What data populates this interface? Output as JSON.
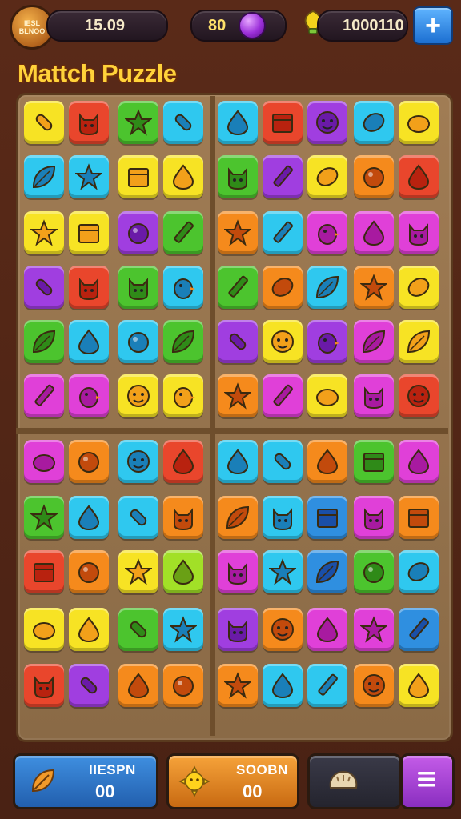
{
  "top_bar": {
    "badge_text": "IESL BLNOO",
    "timer_value": "15.09",
    "gems_value": "80",
    "coins_value": "1000110",
    "add_label": "+"
  },
  "title": "Mattch Puzzle",
  "colors": {
    "yellow": "#f7e324",
    "red": "#e9462c",
    "green": "#4cc42e",
    "cyan": "#2fc8ef",
    "purple": "#a03ee0",
    "magenta": "#e040d8",
    "orange": "#f58a1c",
    "lime": "#a2e027",
    "blue": "#2f8fe0"
  },
  "board": {
    "rows": [
      [
        "yellow",
        "red",
        "green",
        "cyan",
        "cyan",
        "red",
        "purple",
        "cyan",
        "yellow"
      ],
      [
        "cyan",
        "cyan",
        "yellow",
        "yellow",
        "green",
        "purple",
        "yellow",
        "orange",
        "red"
      ],
      [
        "yellow",
        "yellow",
        "purple",
        "green",
        "orange",
        "cyan",
        "magenta",
        "magenta",
        "magenta"
      ],
      [
        "purple",
        "red",
        "green",
        "cyan",
        "green",
        "orange",
        "cyan",
        "orange",
        "yellow"
      ],
      [
        "green",
        "cyan",
        "cyan",
        "green",
        "purple",
        "yellow",
        "purple",
        "magenta",
        "yellow"
      ],
      [
        "magenta",
        "magenta",
        "yellow",
        "yellow",
        "orange",
        "magenta",
        "yellow",
        "magenta",
        "red"
      ],
      [
        "magenta",
        "orange",
        "cyan",
        "red",
        "cyan",
        "cyan",
        "orange",
        "green",
        "magenta"
      ],
      [
        "green",
        "cyan",
        "cyan",
        "orange",
        "orange",
        "cyan",
        "blue",
        "magenta",
        "orange"
      ],
      [
        "red",
        "orange",
        "yellow",
        "lime",
        "magenta",
        "cyan",
        "blue",
        "green",
        "cyan"
      ],
      [
        "yellow",
        "yellow",
        "green",
        "cyan",
        "purple",
        "orange",
        "magenta",
        "magenta",
        "blue"
      ],
      [
        "red",
        "purple",
        "orange",
        "orange",
        "orange",
        "cyan",
        "cyan",
        "orange",
        "yellow"
      ]
    ],
    "icons": [
      [
        "microphone",
        "cat",
        "star",
        "microphone",
        "pear",
        "box",
        "ghost",
        "lemon",
        "blob"
      ],
      [
        "leaf",
        "sun",
        "chair",
        "drop",
        "frog",
        "pencil",
        "bread",
        "donut",
        "shield"
      ],
      [
        "star",
        "piano",
        "ball",
        "wand",
        "splat",
        "pencil",
        "bird",
        "heart",
        "spider"
      ],
      [
        "pill",
        "cat",
        "monster",
        "bird",
        "rocket",
        "lemon",
        "leaf",
        "star",
        "lemon"
      ],
      [
        "dragon",
        "drop",
        "ball",
        "leaf",
        "bottle",
        "face",
        "bird",
        "plant",
        "leaf"
      ],
      [
        "pencil",
        "bird",
        "face",
        "bird",
        "splat",
        "pencil",
        "blob",
        "cat",
        "face"
      ],
      [
        "blob",
        "lens",
        "ghost",
        "drop",
        "lamp",
        "microphone",
        "acorn",
        "cheese",
        "drop"
      ],
      [
        "sun",
        "squid",
        "pill",
        "cat",
        "tree",
        "robot",
        "cart",
        "frog",
        "ruler"
      ],
      [
        "box",
        "ball",
        "star",
        "bell",
        "cat",
        "ribbon",
        "leaf",
        "bomb",
        "lemon"
      ],
      [
        "fish",
        "drop",
        "bottle",
        "star",
        "cat",
        "face",
        "squid",
        "star",
        "carrot"
      ],
      [
        "cat",
        "key",
        "drop",
        "apple",
        "star",
        "drop",
        "pencil",
        "face",
        "bell"
      ]
    ]
  },
  "bottom_bar": {
    "left_label": "IIESPN",
    "left_value": "00",
    "mid_label": "SOOBN",
    "mid_value": "00",
    "left_icon": "leaf-icon",
    "mid_icon": "sun-icon",
    "right_icon": "bread-icon",
    "menu_icon": "menu-icon"
  }
}
